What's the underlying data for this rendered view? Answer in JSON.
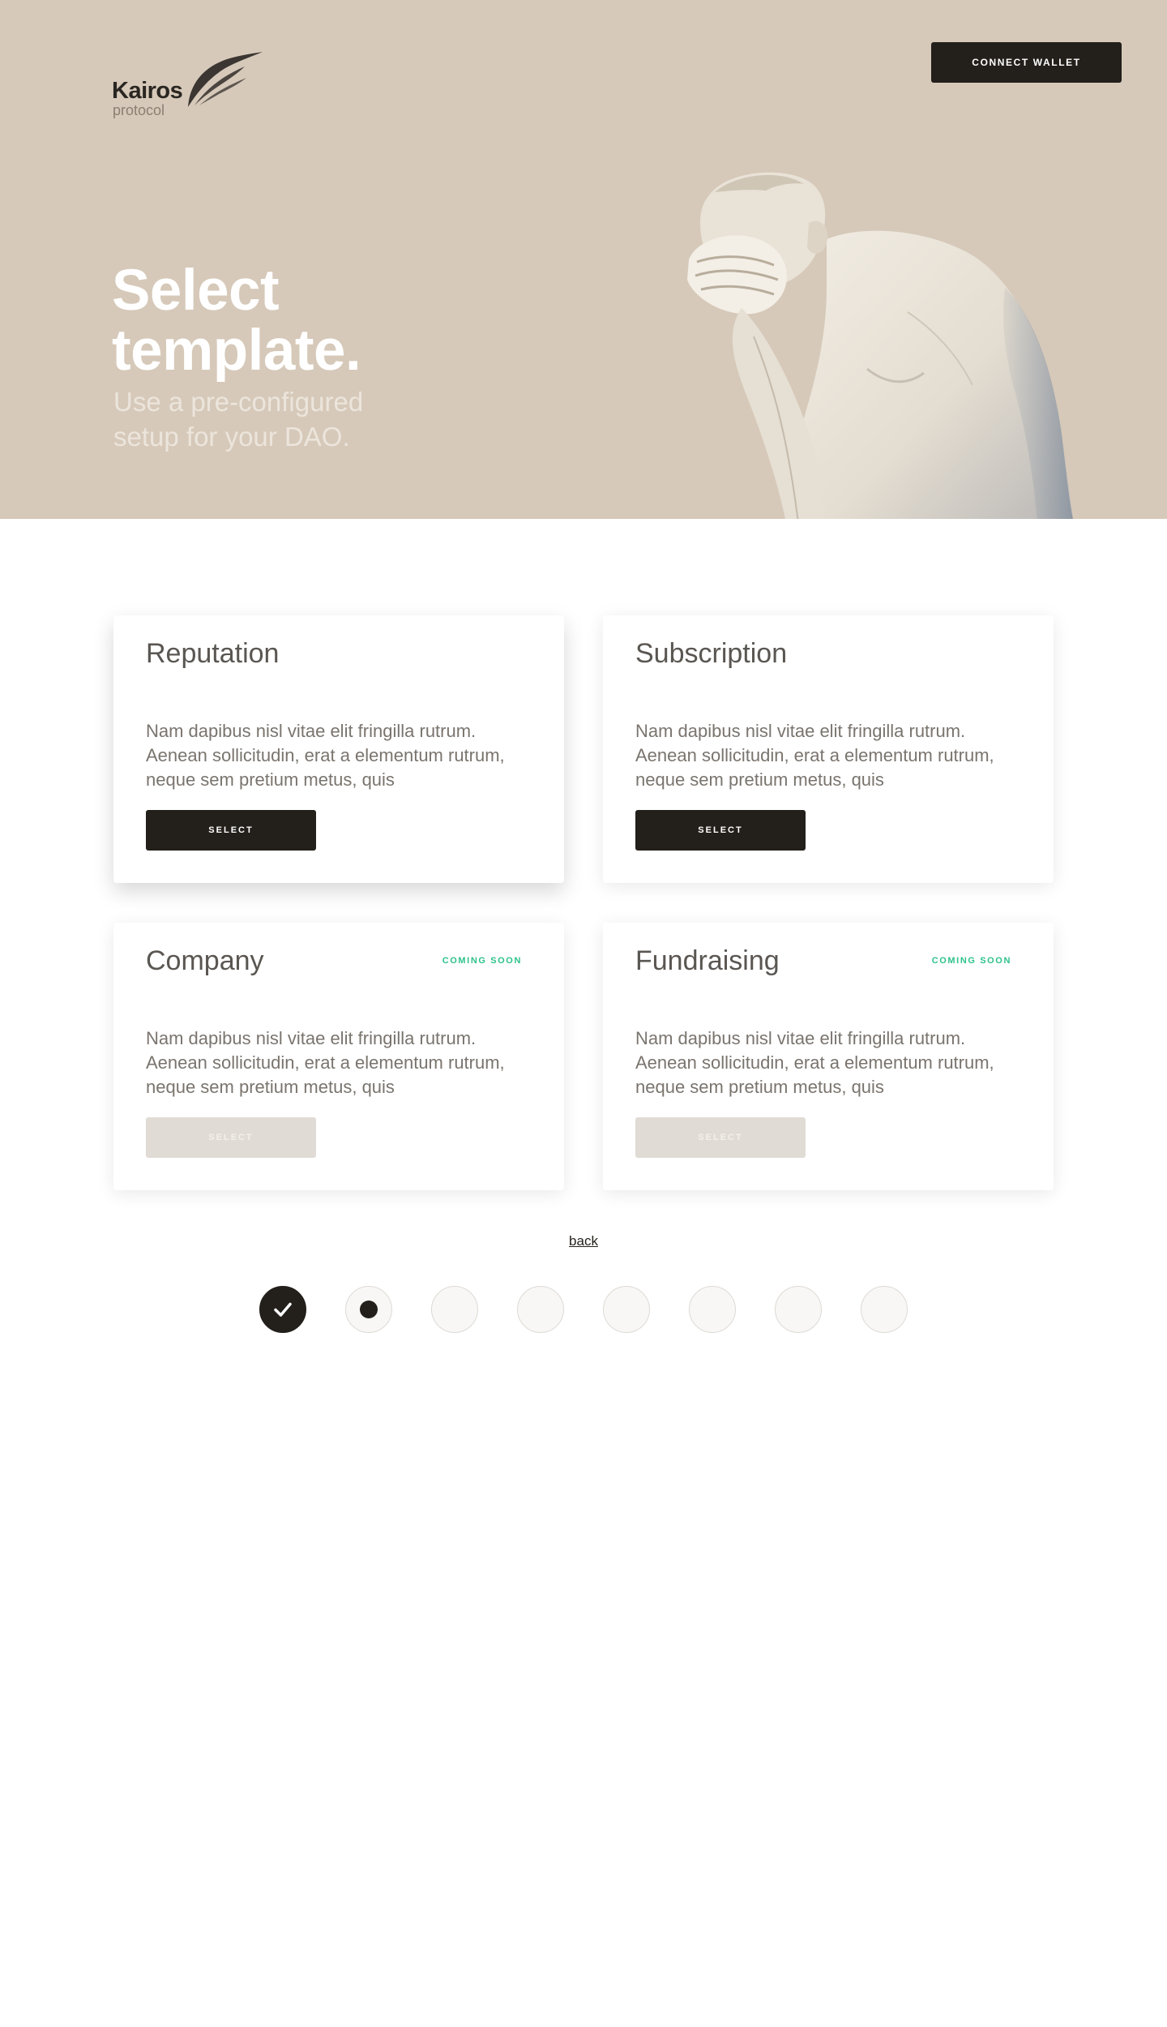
{
  "header": {
    "logo_name": "Kairos",
    "logo_sub": "protocol",
    "connect_label": "CONNECT WALLET"
  },
  "hero": {
    "title": "Select template.",
    "subtitle": "Use a pre-configured setup for your DAO."
  },
  "templates": [
    {
      "title": "Reputation",
      "badge": "",
      "description": "Nam dapibus nisl vitae elit fringilla rutrum. Aenean sollicitudin, erat a elementum rutrum, neque sem pretium metus, quis",
      "button_label": "SELECT",
      "enabled": true
    },
    {
      "title": "Subscription",
      "badge": "",
      "description": "Nam dapibus nisl vitae elit fringilla rutrum. Aenean sollicitudin, erat a elementum rutrum, neque sem pretium metus, quis",
      "button_label": "SELECT",
      "enabled": true
    },
    {
      "title": "Company",
      "badge": "COMING SOON",
      "description": "Nam dapibus nisl vitae elit fringilla rutrum. Aenean sollicitudin, erat a elementum rutrum, neque sem pretium metus, quis",
      "button_label": "SELECT",
      "enabled": false
    },
    {
      "title": "Fundraising",
      "badge": "COMING SOON",
      "description": "Nam dapibus nisl vitae elit fringilla rutrum. Aenean sollicitudin, erat a elementum rutrum, neque sem pretium metus, quis",
      "button_label": "SELECT",
      "enabled": false
    }
  ],
  "navigation": {
    "back_label": "back"
  },
  "steps": {
    "total": 8,
    "completed": 1,
    "current": 2
  },
  "colors": {
    "hero_background": "#d6c9b9",
    "primary_dark": "#231f1b",
    "badge_green": "#2ec28b",
    "disabled_button": "#e0dbd5"
  }
}
